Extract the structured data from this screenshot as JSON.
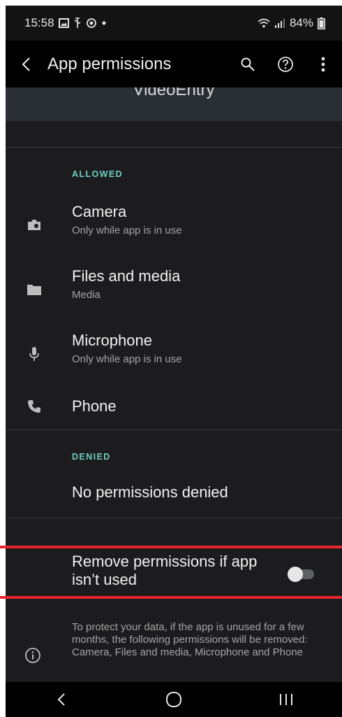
{
  "status_bar": {
    "time": "15:58",
    "battery": "84%",
    "icons": [
      "image-icon",
      "usb-icon",
      "screen-record-icon",
      "dot-icon",
      "wifi-icon",
      "signal-icon",
      "battery-icon"
    ]
  },
  "toolbar": {
    "title": "App permissions",
    "actions": [
      "back-icon",
      "search-icon",
      "help-icon",
      "more-icon"
    ]
  },
  "app_header": {
    "name": "VideoEntry"
  },
  "allowed": {
    "label": "ALLOWED",
    "items": [
      {
        "title": "Camera",
        "subtitle": "Only while app is in use",
        "icon": "camera-icon"
      },
      {
        "title": "Files and media",
        "subtitle": "Media",
        "icon": "folder-icon"
      },
      {
        "title": "Microphone",
        "subtitle": "Only while app is in use",
        "icon": "microphone-icon"
      },
      {
        "title": "Phone",
        "subtitle": "",
        "icon": "phone-icon"
      }
    ]
  },
  "denied": {
    "label": "DENIED",
    "empty_text": "No permissions denied"
  },
  "remove_unused": {
    "label": "Remove permissions if app isn’t used",
    "enabled": false
  },
  "info": {
    "text": "To protect your data, if the app is unused for a few months, the following permissions will be removed: Camera, Files and media, Microphone and Phone"
  },
  "colors": {
    "accent": "#6fd0c0",
    "highlight": "#e5262b",
    "background": "#1c1c1e"
  },
  "nav_bar": {
    "buttons": [
      "back-nav-icon",
      "home-nav-icon",
      "recents-nav-icon"
    ]
  }
}
